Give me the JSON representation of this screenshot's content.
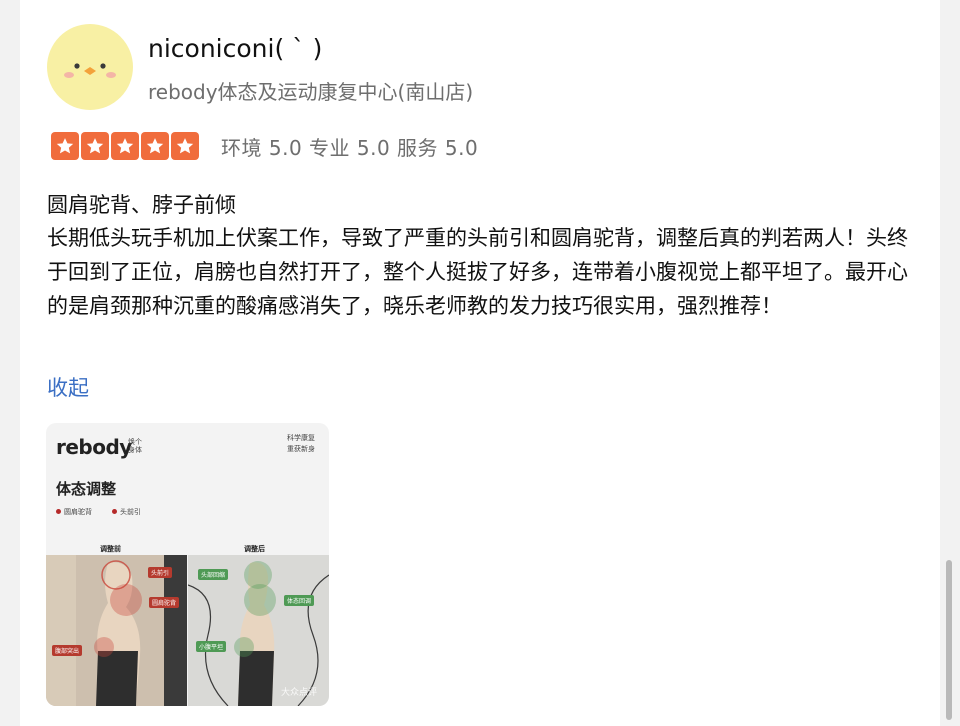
{
  "review": {
    "user": {
      "name": "niconiconi( ˋ )"
    },
    "shop": {
      "name": "rebody体态及运动康复中心(南山店)"
    },
    "rating": {
      "stars": 5,
      "scores_text": "环境 5.0 专业 5.0 服务 5.0"
    },
    "title": "圆肩驼背、脖子前倾",
    "body": "长期低头玩手机加上伏案工作，导致了严重的头前引和圆肩驼背，调整后真的判若两人！头终于回到了正位，肩膀也自然打开了，整个人挺拔了好多，连带着小腹视觉上都平坦了。最开心的是肩颈那种沉重的酸痛感消失了，晓乐老师教的发力技巧很实用，强烈推荐！",
    "collapse_label": "收起"
  },
  "photo": {
    "brand": "rebody",
    "brand_sub_1": "焕个",
    "brand_sub_2": "身体",
    "slogan_1": "科学康复",
    "slogan_2": "重获新身",
    "heading": "体态调整",
    "legend": [
      "圆肩驼背",
      "头前引"
    ],
    "label_before": "调整前",
    "label_after": "调整后",
    "tags": {
      "head_forward": "头前引",
      "rounded_shoulder": "圆肩驼背",
      "belly_out": "腹部突出",
      "head_back": "头部回缩",
      "posture_back": "体态回调",
      "belly_flat": "小腹平坦"
    },
    "watermark": "大众点评"
  },
  "colors": {
    "star": "#f06c3c",
    "link": "#3b6fc4",
    "avatar_bg": "#f8f0a4"
  }
}
